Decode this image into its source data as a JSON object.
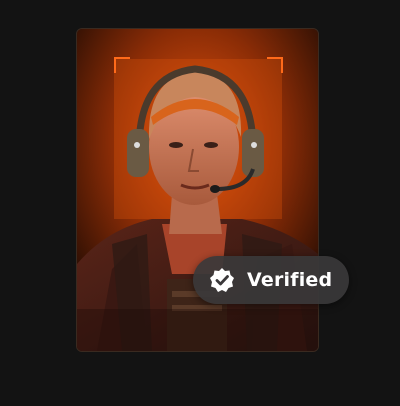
{
  "card": {
    "subject": "operator-portrait",
    "accent_color": "#ff6a1a"
  },
  "badge": {
    "label": "Verified",
    "icon": "verified-check-icon"
  }
}
